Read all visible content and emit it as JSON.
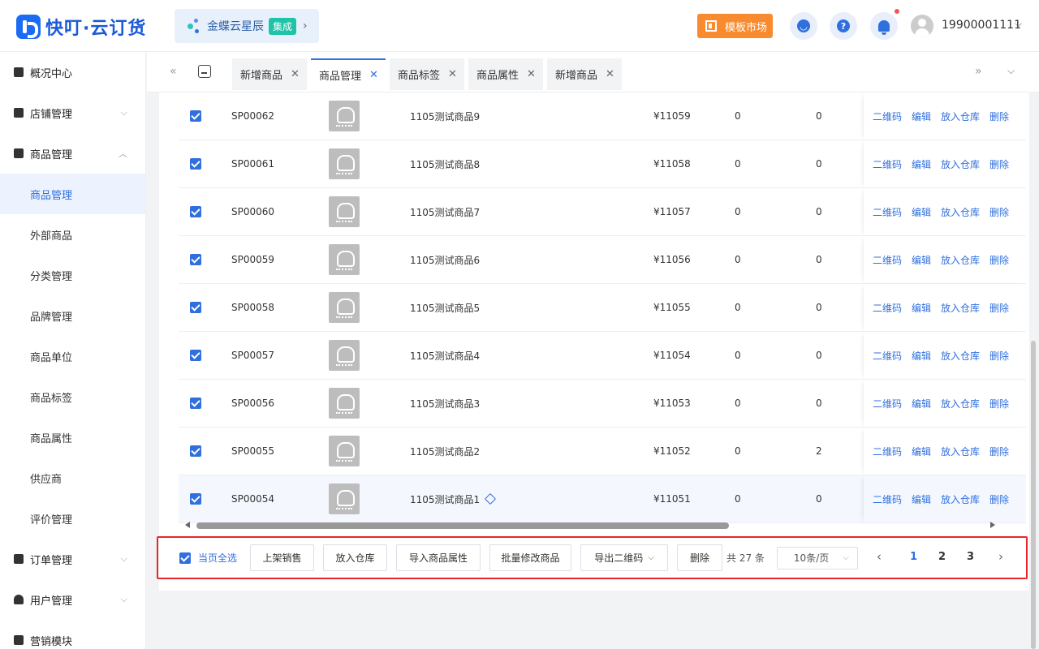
{
  "header": {
    "brand": "快叮·云订货",
    "kingdee": {
      "name": "金蝶云星辰",
      "badge": "集成"
    },
    "market_label": "模板市场",
    "username": "19900001111"
  },
  "sidebar": {
    "groups": [
      {
        "label": "概况中心"
      },
      {
        "label": "店铺管理"
      },
      {
        "label": "商品管理"
      },
      {
        "label": "订单管理"
      },
      {
        "label": "用户管理"
      },
      {
        "label": "营销模块"
      }
    ],
    "items": [
      "商品管理",
      "外部商品",
      "分类管理",
      "品牌管理",
      "商品单位",
      "商品标签",
      "商品属性",
      "供应商",
      "评价管理"
    ]
  },
  "tabs": [
    {
      "label": "新增商品"
    },
    {
      "label": "商品管理"
    },
    {
      "label": "商品标签"
    },
    {
      "label": "商品属性"
    },
    {
      "label": "新增商品"
    }
  ],
  "table": {
    "rows": [
      {
        "code": "SP00062",
        "name": "1105测试商品9",
        "price": "¥11059",
        "c1": "0",
        "c2": "0"
      },
      {
        "code": "SP00061",
        "name": "1105测试商品8",
        "price": "¥11058",
        "c1": "0",
        "c2": "0"
      },
      {
        "code": "SP00060",
        "name": "1105测试商品7",
        "price": "¥11057",
        "c1": "0",
        "c2": "0"
      },
      {
        "code": "SP00059",
        "name": "1105测试商品6",
        "price": "¥11056",
        "c1": "0",
        "c2": "0"
      },
      {
        "code": "SP00058",
        "name": "1105测试商品5",
        "price": "¥11055",
        "c1": "0",
        "c2": "0"
      },
      {
        "code": "SP00057",
        "name": "1105测试商品4",
        "price": "¥11054",
        "c1": "0",
        "c2": "0"
      },
      {
        "code": "SP00056",
        "name": "1105测试商品3",
        "price": "¥11053",
        "c1": "0",
        "c2": "0"
      },
      {
        "code": "SP00055",
        "name": "1105测试商品2",
        "price": "¥11052",
        "c1": "0",
        "c2": "2"
      },
      {
        "code": "SP00054",
        "name": "1105测试商品1",
        "price": "¥11051",
        "c1": "0",
        "c2": "0"
      }
    ],
    "actions": {
      "qr": "二维码",
      "edit": "编辑",
      "warehouse": "放入仓库",
      "delete": "删除"
    }
  },
  "bottom": {
    "select_all": "当页全选",
    "buttons": [
      "上架销售",
      "放入仓库",
      "导入商品属性",
      "批量修改商品",
      "导出二维码",
      "删除"
    ],
    "total": "共 27 条",
    "page_size": "10条/页",
    "pages": [
      "1",
      "2",
      "3"
    ]
  },
  "colors": {
    "primary": "#2f6fde",
    "market": "#f98b2e",
    "highlight_border": "#e8262b"
  }
}
